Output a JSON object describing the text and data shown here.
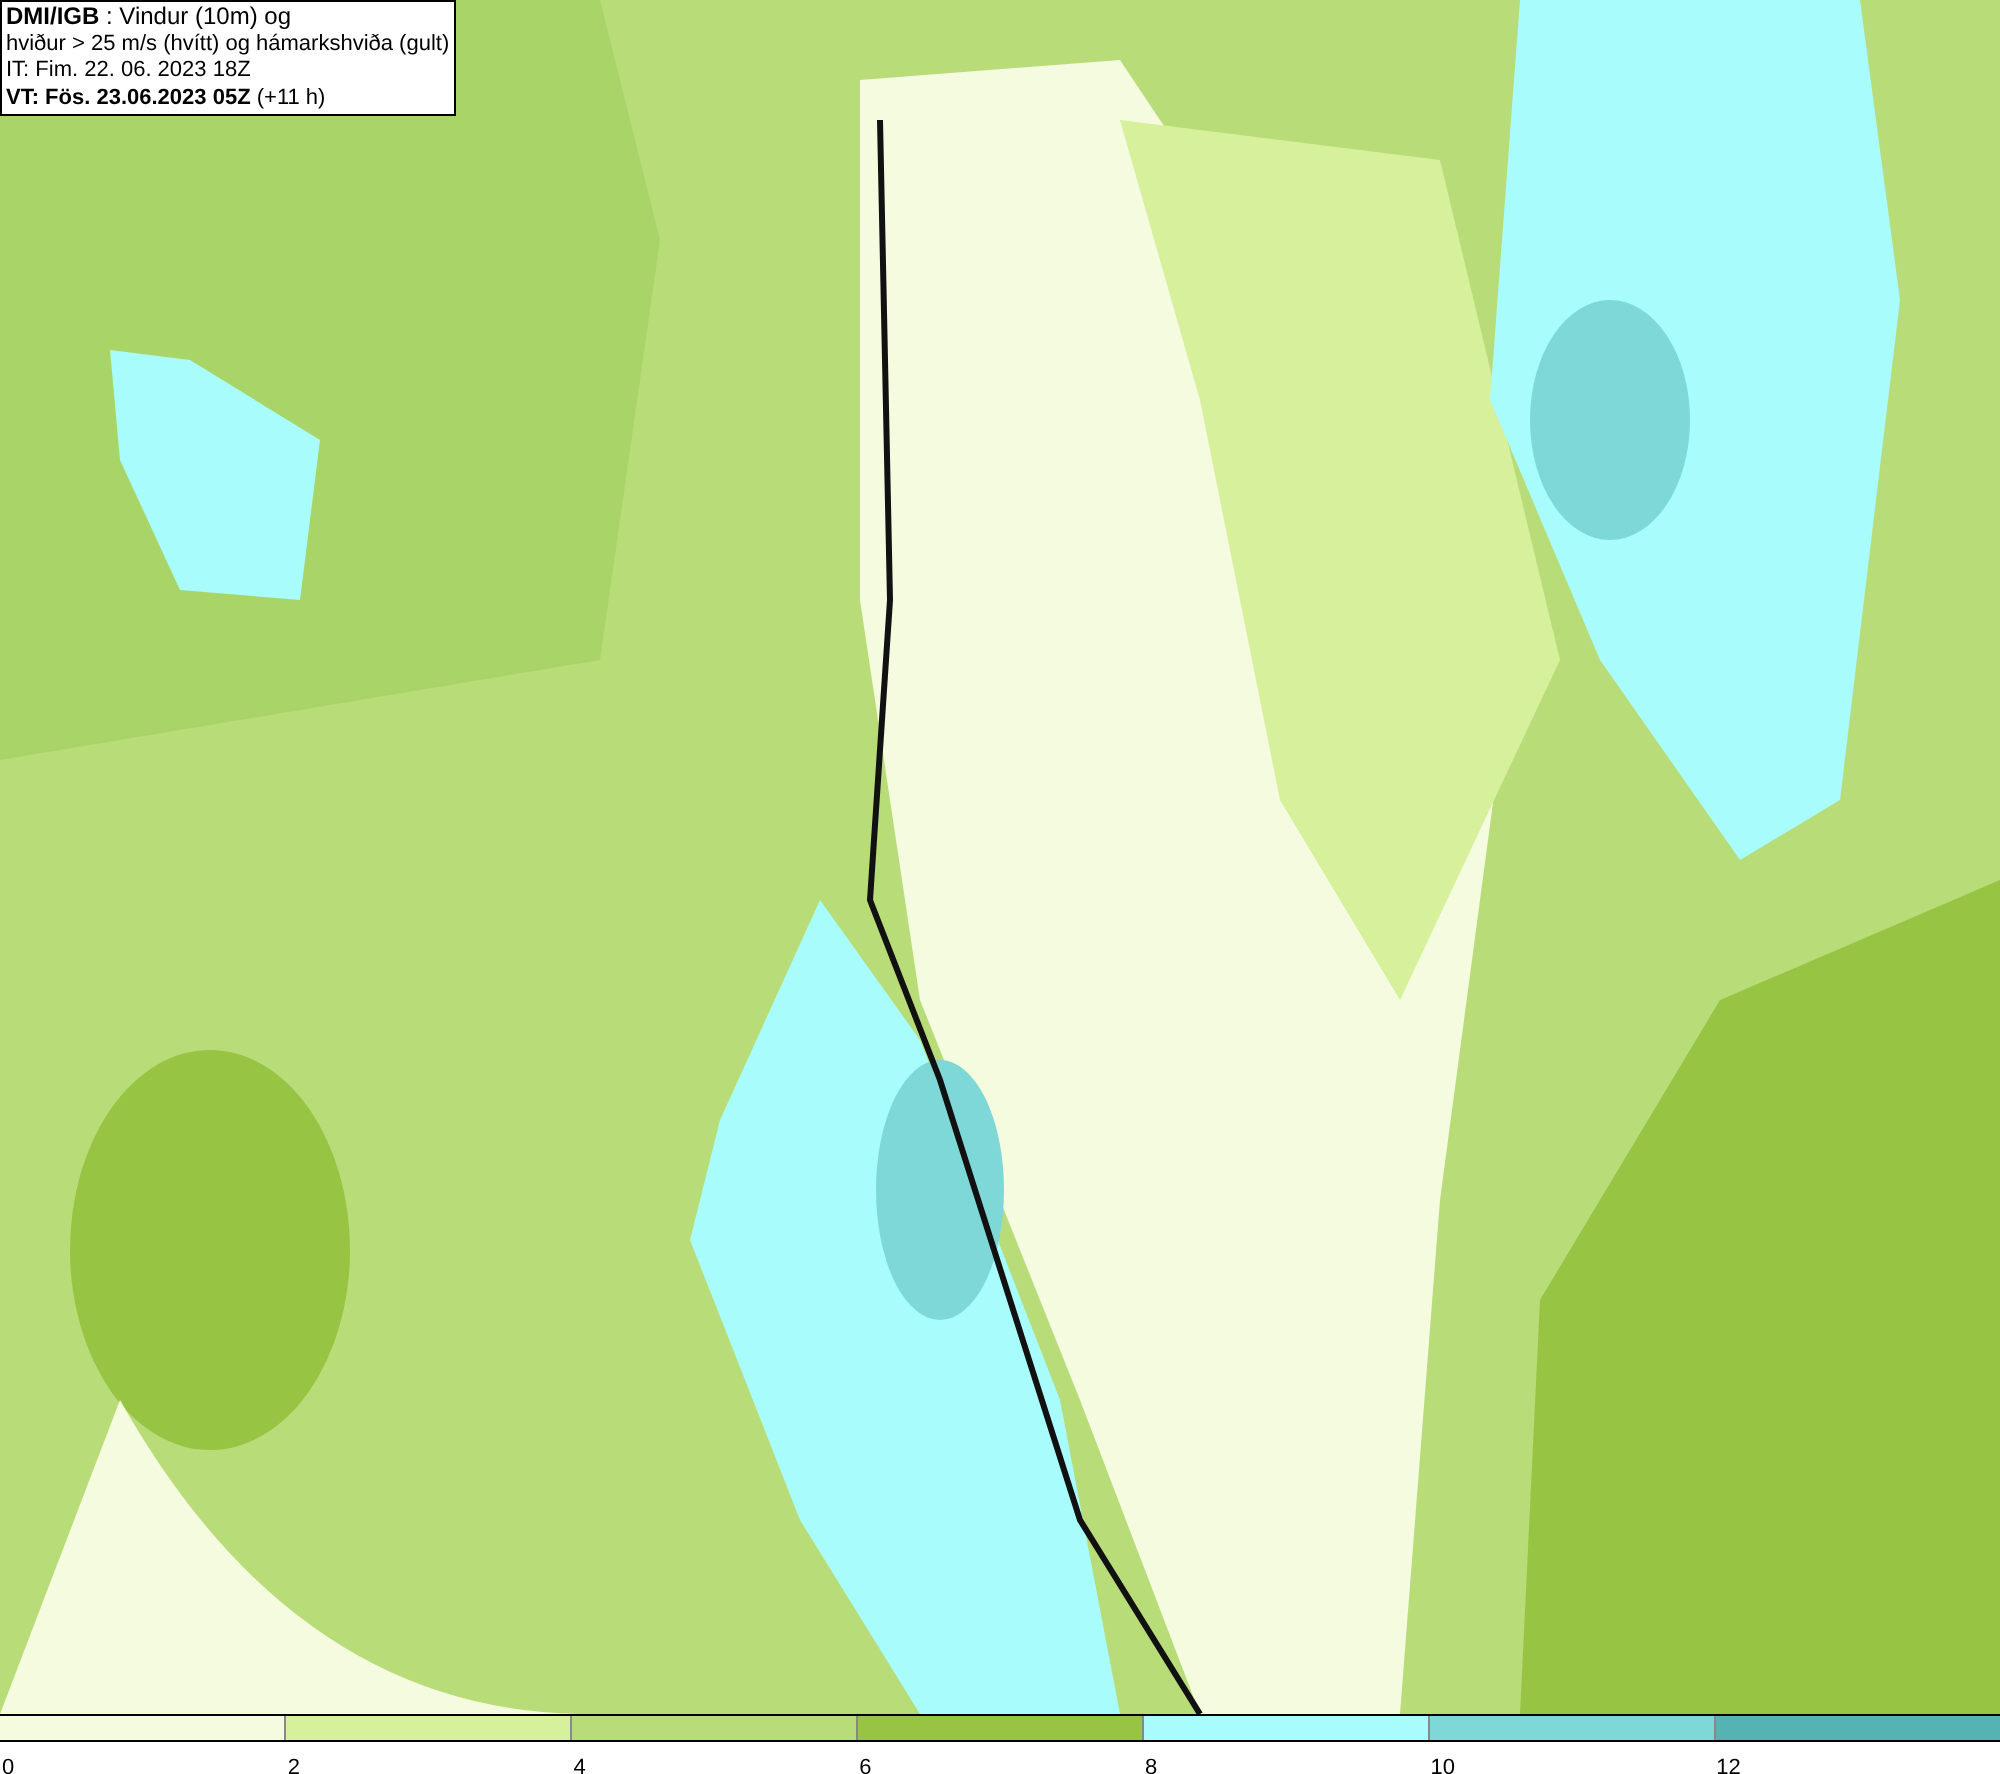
{
  "header": {
    "lines": [
      "**DMI/IGB** : Vindur (10m) og",
      "hviður > 25 m/s (hvítt) og hámarkshviða (gult)",
      "IT: Fim. 22. 06. 2023 18Z",
      "**VT: Fös. 23.06.2023 05Z** (+11 h)"
    ]
  },
  "legend": {
    "bins": [
      {
        "color": "#f5fbdf",
        "label": "0"
      },
      {
        "color": "#d6f09c",
        "label": "2"
      },
      {
        "color": "#b8dc78",
        "label": "4"
      },
      {
        "color": "#98c444",
        "label": "6"
      },
      {
        "color": "#a8fcfc",
        "label": "8"
      },
      {
        "color": "#7ed8d8",
        "label": "10"
      },
      {
        "color": "#55b3b3",
        "label": "12"
      }
    ]
  }
}
